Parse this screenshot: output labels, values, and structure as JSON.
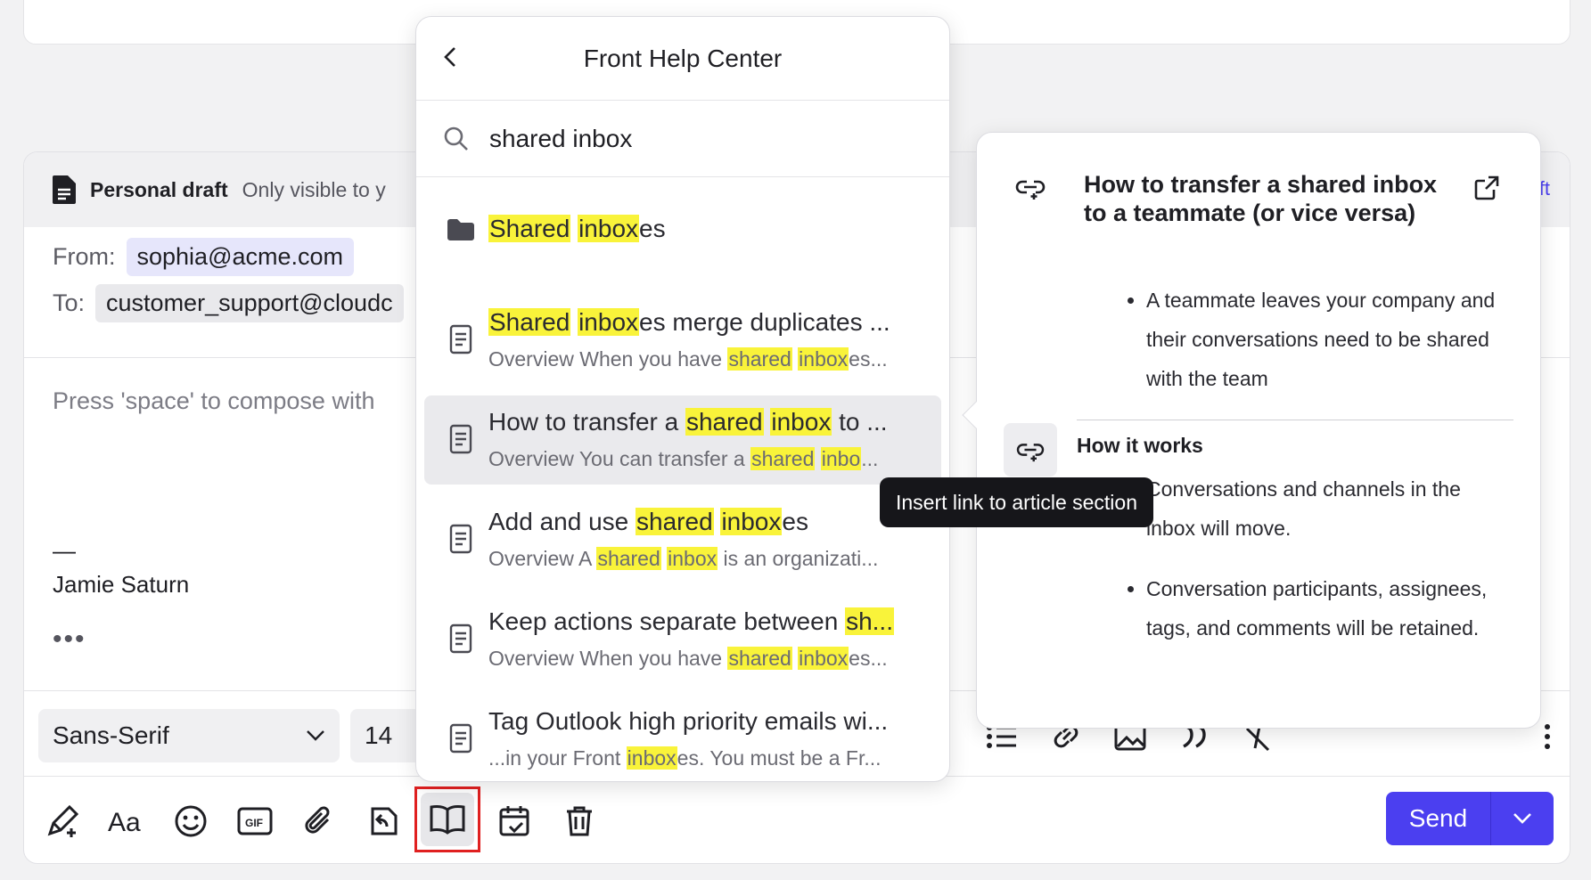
{
  "draft": {
    "title": "Personal draft",
    "subtitle": "Only visible to y",
    "right_link": "ft"
  },
  "from": {
    "label": "From:",
    "value": "sophia@acme.com"
  },
  "to": {
    "label": "To:",
    "value": "customer_support@cloudc"
  },
  "body": {
    "placeholder": "Press 'space' to compose with",
    "signature_dash": "—",
    "signature_name": "Jamie Saturn",
    "more": "•••"
  },
  "format": {
    "font": "Sans-Serif",
    "size": "14"
  },
  "send": {
    "label": "Send"
  },
  "help_center": {
    "title": "Front Help Center",
    "search_query": "shared inbox",
    "results": [
      {
        "type": "folder",
        "title_html": "<mark>Shared</mark> <mark>inbox</mark>es",
        "snippet_html": ""
      },
      {
        "type": "article",
        "title_html": "<mark>Shared</mark> <mark>inbox</mark>es merge duplicates ...",
        "snippet_html": "Overview When you have <mark>shared</mark> <mark>inbox</mark>es..."
      },
      {
        "type": "article",
        "title_html": "How to transfer a <mark>shared</mark> <mark>inbox</mark> to ...",
        "snippet_html": "Overview You can transfer a <mark>shared</mark> <mark>inbo</mark>..."
      },
      {
        "type": "article",
        "title_html": "Add and use <mark>shared</mark> <mark>inbox</mark>es",
        "snippet_html": "Overview A <mark>shared</mark> <mark>inbox</mark> is an organizati..."
      },
      {
        "type": "article",
        "title_html": "Keep actions separate between <mark>sh...</mark>",
        "snippet_html": "Overview When you have <mark>shared</mark> <mark>inbox</mark>es..."
      },
      {
        "type": "article",
        "title_html": "Tag Outlook high priority emails wi...",
        "snippet_html": "...in your Front <mark>inbox</mark>es. You must be a Fr..."
      }
    ]
  },
  "preview": {
    "title": "How to transfer a shared inbox to a teammate (or vice versa)",
    "bullets_top": [
      "A teammate leaves your company and their conversations need to be shared with the team"
    ],
    "section_title": "How it works",
    "bullets_bottom": [
      "Conversations and channels in the inbox will move.",
      "Conversation participants, assignees, tags, and comments will be retained."
    ]
  },
  "tooltip": "Insert link to article section"
}
